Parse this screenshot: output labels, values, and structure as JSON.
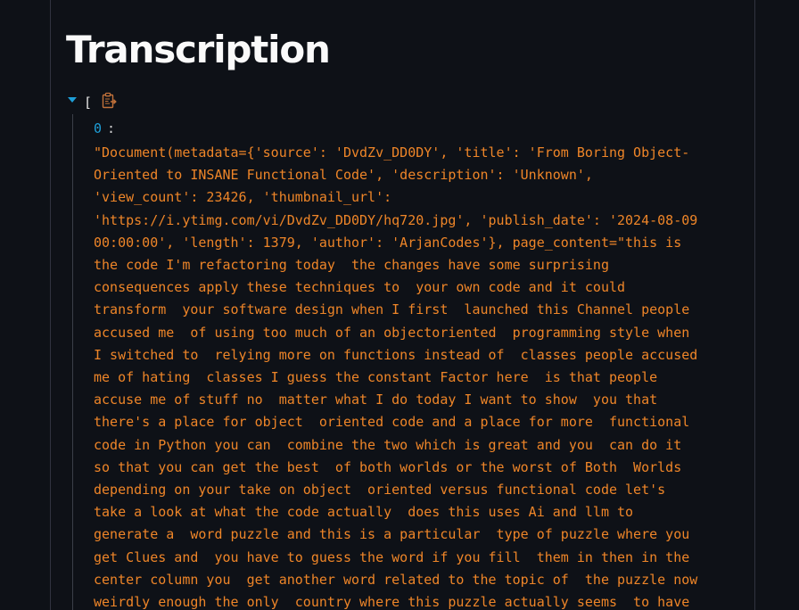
{
  "page": {
    "title": "Transcription"
  },
  "json_viewer": {
    "open_bracket": "[",
    "copy_icon": "clipboard-copy-icon",
    "items": [
      {
        "key": "0",
        "value_lines": [
          "\"Document(metadata={'source': 'DvdZv_DD0DY', 'title': 'From Boring Object-",
          "Oriented to INSANE Functional Code', 'description': 'Unknown',",
          "'view_count': 23426, 'thumbnail_url':",
          "'https://i.ytimg.com/vi/DvdZv_DD0DY/hq720.jpg', 'publish_date': '2024-08-09",
          "00:00:00', 'length': 1379, 'author': 'ArjanCodes'}, page_content=\"this is",
          "the code I'm refactoring today  the changes have some surprising",
          "consequences apply these techniques to  your own code and it could",
          "transform  your software design when I first  launched this Channel people",
          "accused me  of using too much of an objectoriented  programming style when",
          "I switched to  relying more on functions instead of  classes people accused",
          "me of hating  classes I guess the constant Factor here  is that people",
          "accuse me of stuff no  matter what I do today I want to show  you that",
          "there's a place for object  oriented code and a place for more  functional",
          "code in Python you can  combine the two which is great and you  can do it",
          "so that you can get the best  of both worlds or the worst of Both  Worlds",
          "depending on your take on object  oriented versus functional code let's",
          "take a look at what the code actually  does this uses Ai and llm to",
          "generate a  word puzzle and this is a particular  type of puzzle where you",
          "get Clues and  you have to guess the word if you fill  them in then in the",
          "center column you  get another word related to the topic of  the puzzle now",
          "weirdly enough the only  country where this puzzle actually seems  to have"
        ]
      }
    ]
  },
  "colors": {
    "background": "#0e1117",
    "title": "#fafafa",
    "key": "#1e9fd8",
    "string": "#ee8528",
    "guide": "#3b3f48"
  }
}
